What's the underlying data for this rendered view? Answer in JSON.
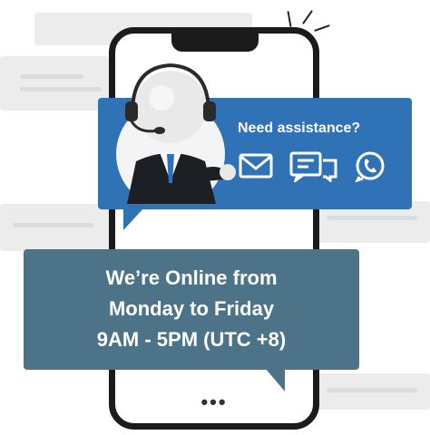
{
  "assist": {
    "title": "Need assistance?",
    "bubble_color": "#2f72b5",
    "icons": [
      "email-icon",
      "chat-icon",
      "whatsapp-icon"
    ]
  },
  "hours": {
    "line1": "We’re Online from",
    "line2": "Monday to Friday",
    "line3": "9AM - 5PM (UTC +8)",
    "bubble_color": "#4c7387"
  },
  "phone": {
    "typing_dots": "•••"
  }
}
